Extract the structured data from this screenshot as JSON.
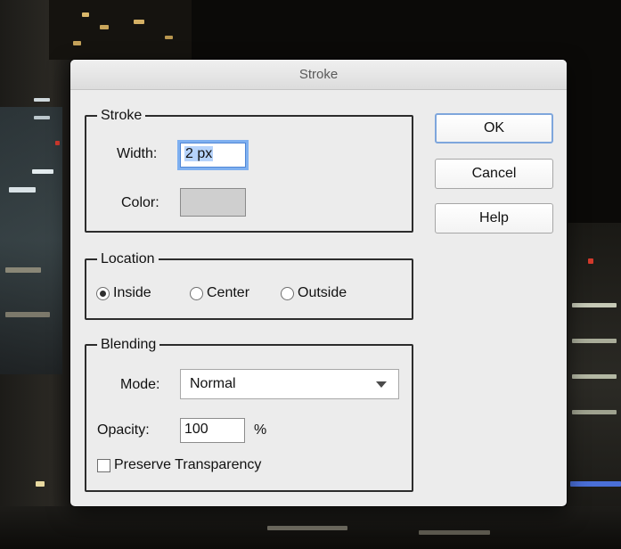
{
  "dialog": {
    "title": "Stroke",
    "stroke_group": {
      "legend": "Stroke",
      "width_label": "Width:",
      "width_value": "2 px",
      "color_label": "Color:",
      "color_swatch": "#cfcfcf"
    },
    "location_group": {
      "legend": "Location",
      "options": [
        {
          "label": "Inside",
          "checked": true
        },
        {
          "label": "Center",
          "checked": false
        },
        {
          "label": "Outside",
          "checked": false
        }
      ]
    },
    "blending_group": {
      "legend": "Blending",
      "mode_label": "Mode:",
      "mode_value": "Normal",
      "opacity_label": "Opacity:",
      "opacity_value": "100",
      "opacity_unit": "%",
      "preserve_label": "Preserve Transparency",
      "preserve_checked": false
    },
    "buttons": {
      "ok": "OK",
      "cancel": "Cancel",
      "help": "Help"
    }
  }
}
